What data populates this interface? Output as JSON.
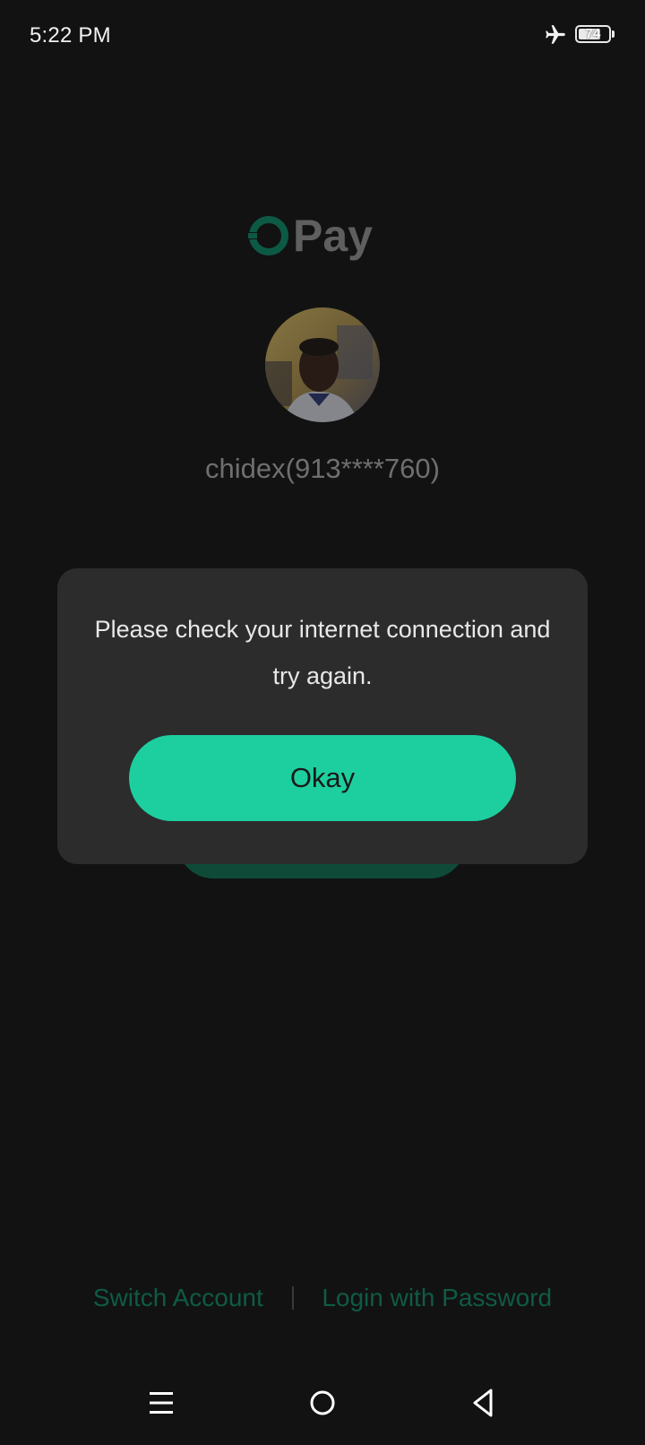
{
  "status_bar": {
    "time": "5:22 PM",
    "airplane_icon": "airplane-icon",
    "battery_level": "74"
  },
  "brand": {
    "name": "Pay",
    "logo_icon": "opay-logo",
    "accent_color": "#0f5b45"
  },
  "account": {
    "avatar": "user-avatar",
    "display_name": "chidex(913****760)"
  },
  "dialog": {
    "message": "Please check your internet connection and try again.",
    "okay_label": "Okay",
    "button_color": "#1dcf9f"
  },
  "footer": {
    "switch_account_label": "Switch Account",
    "login_password_label": "Login with Password"
  },
  "nav_bar": {
    "menu_icon": "menu-icon",
    "home_icon": "home-icon",
    "back_icon": "back-icon"
  }
}
